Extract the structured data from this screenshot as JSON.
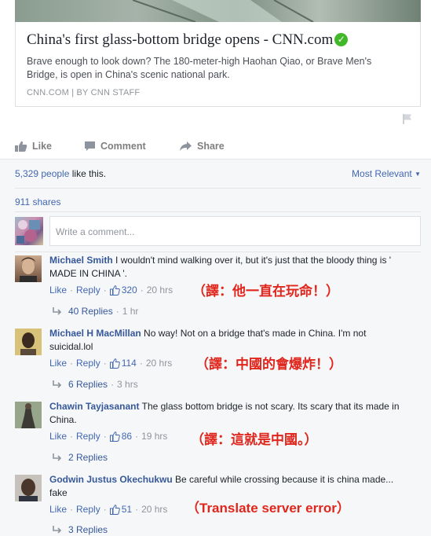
{
  "link_card": {
    "title": "China's first glass-bottom bridge opens - CNN.com",
    "description": "Brave enough to look down? The 180-meter-high Haohan Qiao, or Brave Men's Bridge, is open in China's scenic national park.",
    "source": "CNN.COM | BY CNN STAFF"
  },
  "actions": {
    "like": "Like",
    "comment": "Comment",
    "share": "Share"
  },
  "summary": {
    "likes_count": "5,329 people",
    "likes_suffix": " like this.",
    "sort_label": "Most Relevant",
    "shares": "911 shares"
  },
  "composer": {
    "placeholder": "Write a comment..."
  },
  "comments": [
    {
      "name": "Michael Smith",
      "text": "I wouldn't mind walking over it, but it's just that the bloody thing is ' MADE IN CHINA '.",
      "like": "Like",
      "reply": "Reply",
      "likes": "320",
      "time": "20 hrs",
      "replies": "40 Replies",
      "replies_time": "1 hr",
      "annotation": "（譯：他一直在玩命！）"
    },
    {
      "name": "Michael H MacMillan",
      "text": "No way! Not on a bridge that's made in China. I'm not suicidal.lol",
      "like": "Like",
      "reply": "Reply",
      "likes": "114",
      "time": "20 hrs",
      "replies": "6 Replies",
      "replies_time": "3 hrs",
      "annotation": "（譯：中國的會爆炸！）"
    },
    {
      "name": "Chawin Tayjasanant",
      "text": "The glass bottom bridge is not scary. Its scary that its made in China.",
      "like": "Like",
      "reply": "Reply",
      "likes": "86",
      "time": "19 hrs",
      "replies": "2 Replies",
      "annotation": "（譯：這就是中國。）"
    },
    {
      "name": "Godwin Justus Okechukwu",
      "text": "Be careful while crossing because it is china made... fake",
      "like": "Like",
      "reply": "Reply",
      "likes": "51",
      "time": "20 hrs",
      "replies": "3 Replies",
      "annotation": "（Translate server error）"
    }
  ],
  "colors": {
    "link_blue": "#4267b2",
    "name_blue": "#365899",
    "annotation_red": "#e0261c",
    "verified_green": "#42b72a"
  },
  "icons": [
    "like-thumb-icon",
    "comment-bubble-icon",
    "share-arrow-icon",
    "flag-icon",
    "verified-check-icon",
    "reply-arrow-icon",
    "caret-down-icon"
  ]
}
